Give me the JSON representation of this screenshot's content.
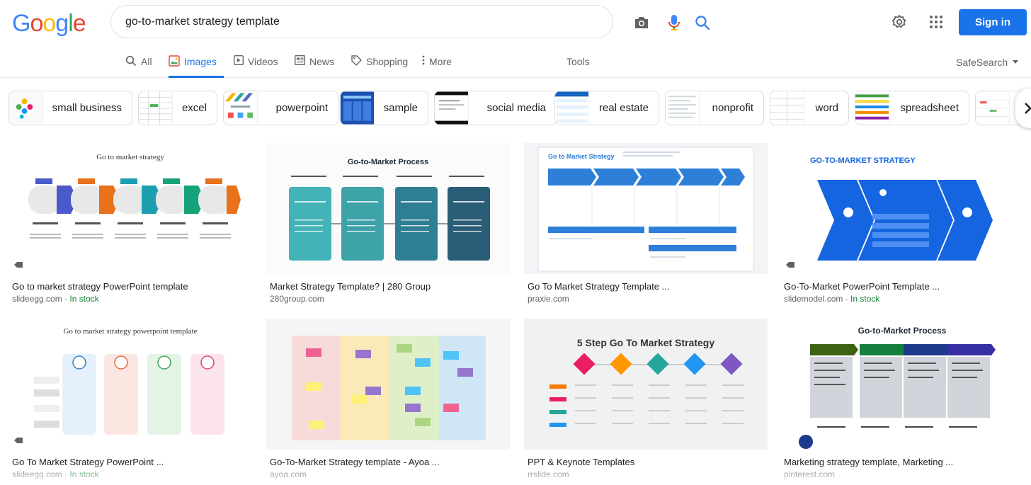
{
  "header": {
    "logo_letters": [
      {
        "ch": "G",
        "color": "#4285f4"
      },
      {
        "ch": "o",
        "color": "#ea4335"
      },
      {
        "ch": "o",
        "color": "#fbbc05"
      },
      {
        "ch": "g",
        "color": "#4285f4"
      },
      {
        "ch": "l",
        "color": "#34a853"
      },
      {
        "ch": "e",
        "color": "#ea4335"
      }
    ],
    "search_query": "go-to-market strategy template",
    "sign_in_label": "Sign in"
  },
  "tabs": [
    {
      "label": "All",
      "icon": "search-icon"
    },
    {
      "label": "Images",
      "icon": "image-icon",
      "active": true
    },
    {
      "label": "Videos",
      "icon": "play-icon"
    },
    {
      "label": "News",
      "icon": "news-icon"
    },
    {
      "label": "Shopping",
      "icon": "tag-icon"
    },
    {
      "label": "More",
      "icon": "more-vert-icon"
    }
  ],
  "tools_label": "Tools",
  "safesearch_label": "SafeSearch",
  "chips": [
    {
      "label": "small business"
    },
    {
      "label": "excel"
    },
    {
      "label": "powerpoint"
    },
    {
      "label": "sample"
    },
    {
      "label": "social media"
    },
    {
      "label": "real estate"
    },
    {
      "label": "nonprofit"
    },
    {
      "label": "word"
    },
    {
      "label": "spreadsheet"
    }
  ],
  "results": [
    {
      "title": "Go to market strategy PowerPoint template",
      "source": "slideegg.com",
      "stock": "In stock",
      "thumb_text": "Go to market strategy"
    },
    {
      "title": "Market Strategy Template? | 280 Group",
      "source": "280group.com",
      "stock": "",
      "thumb_text": "Go-to-Market Process"
    },
    {
      "title": "Go To Market Strategy Template ...",
      "source": "praxie.com",
      "stock": "",
      "thumb_text": "Go to Market Strategy"
    },
    {
      "title": "Go-To-Market PowerPoint Template ...",
      "source": "slidemodel.com",
      "stock": "In stock",
      "thumb_text": "GO-TO-MARKET STRATEGY"
    },
    {
      "title": "Go To Market Strategy PowerPoint ...",
      "source": "slideegg.com",
      "stock": "In stock",
      "thumb_text": "Go to market strategy powerpoint template"
    },
    {
      "title": "Go-To-Market Strategy template - Ayoa ...",
      "source": "ayoa.com",
      "stock": "",
      "thumb_text": ""
    },
    {
      "title": "PPT & Keynote Templates",
      "source": "rrslide.com",
      "stock": "",
      "thumb_text": "5 Step Go To Market Strategy"
    },
    {
      "title": "Marketing strategy template, Marketing ...",
      "source": "pinterest.com",
      "stock": "",
      "thumb_text": "Go-to-Market Process"
    }
  ],
  "source_separator": " · ",
  "colors": {
    "accent": "#1a73e8",
    "in_stock": "#188038"
  }
}
